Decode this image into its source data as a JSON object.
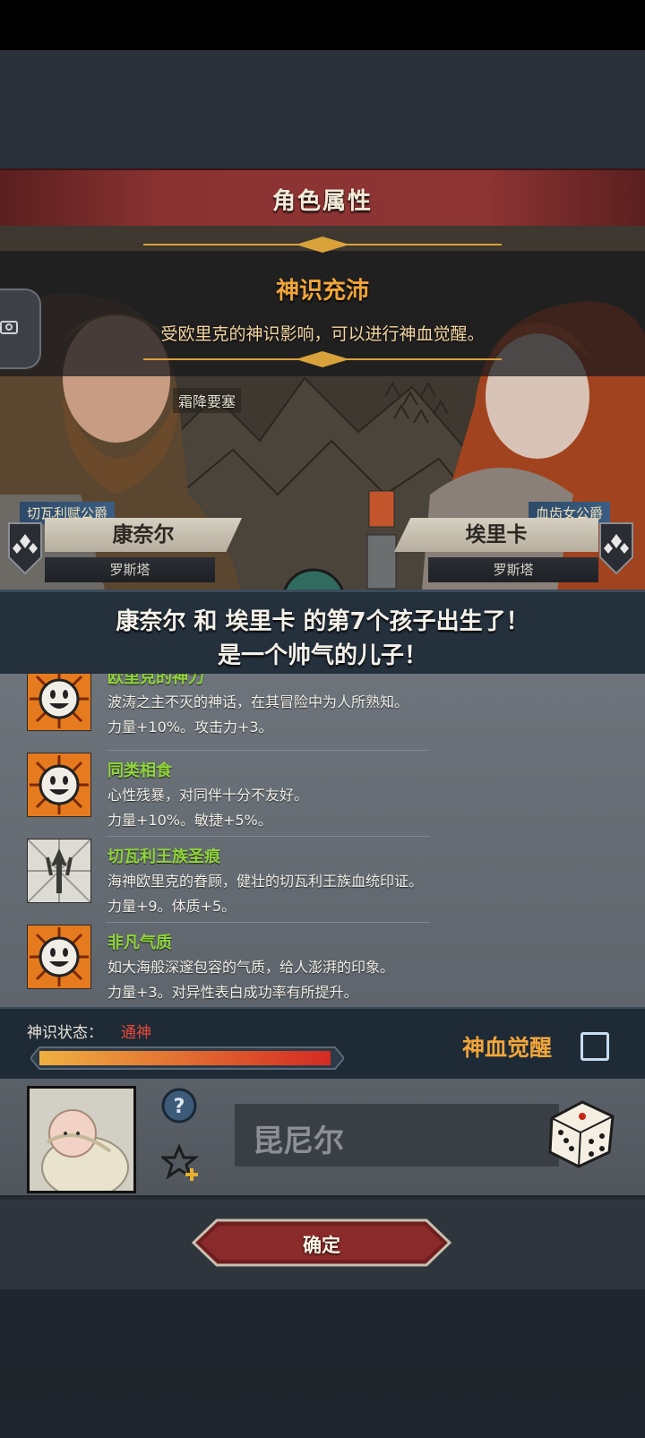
{
  "window_title": "角色属性",
  "banner": {
    "title": "神识充沛",
    "subtitle": "受欧里克的神识影响，可以进行神血觉醒。"
  },
  "location": "霜降要塞",
  "father": {
    "title": "切瓦利赋公爵",
    "name": "康奈尔",
    "place": "罗斯塔"
  },
  "mother": {
    "title": "血齿女公爵",
    "name": "埃里卡",
    "place": "罗斯塔"
  },
  "announcement": {
    "line1": "康奈尔 和 埃里卡 的第7个孩子出生了！",
    "line2": "是一个帅气的儿子！"
  },
  "traits": [
    {
      "name": "欧里克的神力",
      "desc": "波涛之主不灭的神话，在其冒险中为人所熟知。",
      "effect": "力量+10%。攻击力+3。",
      "icon": "smiley-icon"
    },
    {
      "name": "同类相食",
      "desc": "心性残暴，对同伴十分不友好。",
      "effect": "力量+10%。敏捷+5%。",
      "icon": "smiley-icon"
    },
    {
      "name": "切瓦利王族圣痕",
      "desc": "海神欧里克的眷顾，健壮的切瓦利王族血统印证。",
      "effect": "力量+9。体质+5。",
      "icon": "trident-icon"
    },
    {
      "name": "非凡气质",
      "desc": "如大海般深邃包容的气质，给人澎湃的印象。",
      "effect": "力量+3。对异性表白成功率有所提升。",
      "icon": "smiley-icon"
    }
  ],
  "status": {
    "label": "神识状态：",
    "value": "通神",
    "progress": 1.0,
    "value_color": "#e94a3a"
  },
  "awaken_label": "神血觉醒",
  "child": {
    "name": "昆尼尔"
  },
  "confirm_label": "确定"
}
